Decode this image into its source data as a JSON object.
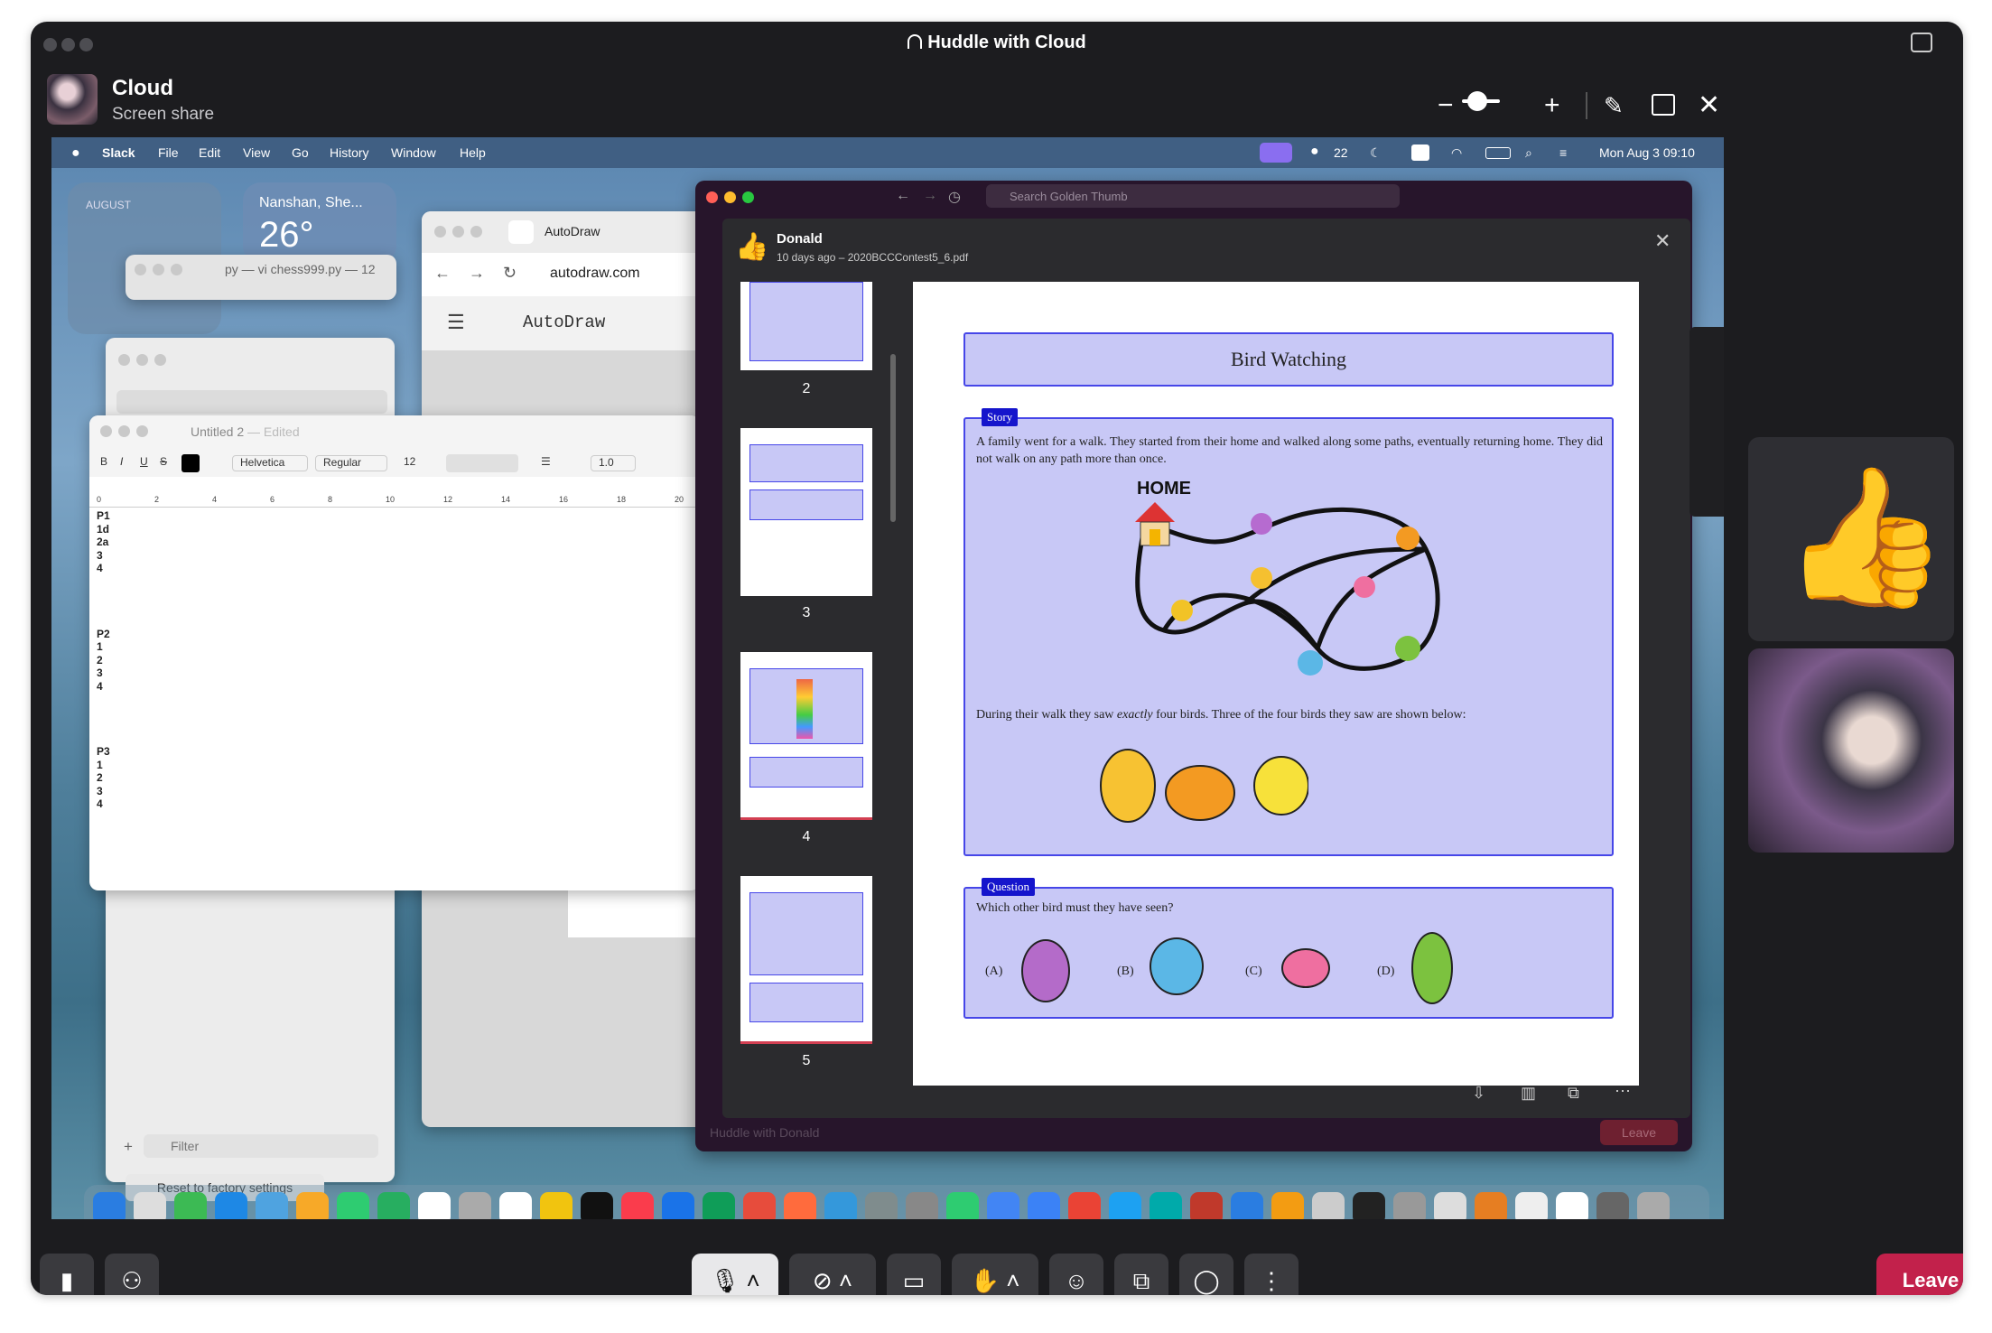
{
  "window": {
    "title": "Huddle with Cloud"
  },
  "sharer": {
    "name": "Cloud",
    "subtitle": "Screen share"
  },
  "mac_menu": {
    "app": "Slack",
    "items": [
      "File",
      "Edit",
      "View",
      "Go",
      "History",
      "Window",
      "Help"
    ],
    "wechat_count": "22",
    "clock": "Mon Aug 3  09:10"
  },
  "widgets": {
    "calendar_month": "AUGUST",
    "weather_city": "Nanshan, She...",
    "weather_temp": "26°"
  },
  "terminal": {
    "title": "py — vi chess999.py — 12"
  },
  "autodraw": {
    "tab": "AutoDraw",
    "url": "autodraw.com",
    "app_title": "AutoDraw"
  },
  "textedit": {
    "title": "Untitled 2",
    "edited": "— Edited",
    "font": "Helvetica",
    "style": "Regular",
    "size": "12",
    "spacing": "1.0",
    "ruler": [
      "0",
      "2",
      "4",
      "6",
      "8",
      "10",
      "12",
      "14",
      "16",
      "18",
      "20"
    ],
    "lines": [
      "P1",
      "1d",
      "2a",
      "3",
      "4",
      "",
      "",
      "",
      "",
      "P2",
      "1",
      "2",
      "3",
      "4",
      "",
      "",
      "",
      "",
      "P3",
      "1",
      "2",
      "3",
      "4"
    ]
  },
  "finder": {
    "filter_placeholder": "Filter",
    "reset_button": "Reset to factory settings"
  },
  "slack": {
    "search_placeholder": "Search Golden Thumb",
    "file_owner": "Donald",
    "file_meta": "10 days ago – 2020BCCContest5_6.pdf",
    "huddle_bar": "Huddle with Donald",
    "leave_ghost": "Leave"
  },
  "pdf": {
    "page_labels": [
      "2",
      "3",
      "4",
      "5"
    ],
    "title": "Bird Watching",
    "story_tag": "Story",
    "story_text": "A family went for a walk. They started from their home and walked along some paths, eventually returning home. They did not walk on any path more than once.",
    "home_label": "HOME",
    "sighting_text_pre": "During their walk they saw ",
    "sighting_text_em": "exactly",
    "sighting_text_post": " four birds. Three of the four birds they saw are shown below:",
    "question_tag": "Question",
    "question_text": "Which other bird must they have seen?",
    "options": [
      "(A)",
      "(B)",
      "(C)",
      "(D)"
    ]
  },
  "controls": {
    "leave": "Leave"
  },
  "colors": {
    "leave": "#c2214b",
    "pdf_box": "#c8c8f6",
    "pdf_border": "#4646e8",
    "slack_bg": "#27152b"
  }
}
